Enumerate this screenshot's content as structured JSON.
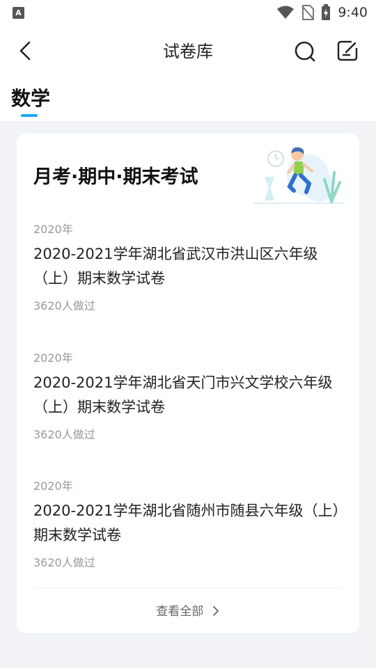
{
  "status_bar": {
    "time": "9:40",
    "app_icon": "A"
  },
  "header": {
    "title": "试卷库",
    "back_icon": "chevron-left-icon",
    "search_icon": "search-icon",
    "edit_icon": "edit-icon"
  },
  "tabs": {
    "active_label": "数学",
    "indicator_color": "#1ea7f0"
  },
  "section": {
    "title": "月考·期中·期末考试",
    "papers": [
      {
        "year": "2020年",
        "title": "2020-2021学年湖北省武汉市洪山区六年级（上）期末数学试卷",
        "count": "3620人做过"
      },
      {
        "year": "2020年",
        "title": "2020-2021学年湖北省天门市兴文学校六年级（上）期末数学试卷",
        "count": "3620人做过"
      },
      {
        "year": "2020年",
        "title": "2020-2021学年湖北省随州市随县六年级（上）期末数学试卷",
        "count": "3620人做过"
      }
    ],
    "view_all_label": "查看全部"
  }
}
